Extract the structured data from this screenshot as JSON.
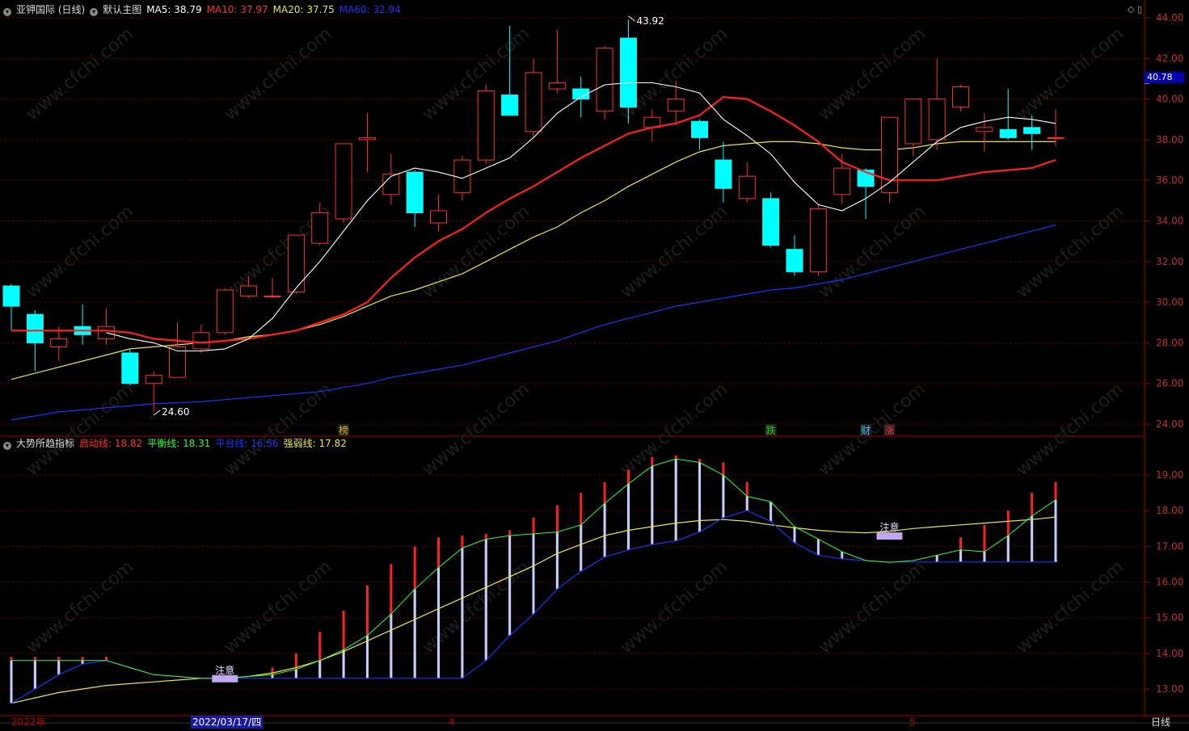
{
  "main_header": {
    "title": "亚钾国际 (日线)",
    "indicator": "默认主图",
    "ma5": "MA5: 38.79",
    "ma10": "MA10: 37.97",
    "ma20": "MA20: 37.75",
    "ma60": "MA60: 32.94"
  },
  "sub_header": {
    "title": "大势所趋指标",
    "qidong": "启动线: 18.82",
    "pingheng": "平衡线: 18.31",
    "pingtai": "平台线: 16.56",
    "qiangruo": "强弱线: 17.82"
  },
  "current_price": "40.78",
  "xaxis": {
    "year": "2022年",
    "cursor_date": "2022/03/17/四",
    "month_4": "4",
    "month_5": "5",
    "period": "日线"
  },
  "watermark": "www.cfchi.com",
  "colors": {
    "up": "#ff3030",
    "down": "#00ffff",
    "ma5": "#ffffff",
    "ma10": "#ff2020",
    "ma20": "#e8e840",
    "ma60": "#2030ff",
    "grid": "#a00000"
  },
  "chart_data": [
    {
      "type": "candlestick",
      "title": "亚钾国际 (日线)",
      "y_ticks": [
        "44.00",
        "42.00",
        "40.00",
        "38.00",
        "36.00",
        "34.00",
        "32.00",
        "30.00",
        "28.00",
        "26.00",
        "24.00"
      ],
      "ylim": [
        23.98,
        44.8
      ],
      "candles": [
        {
          "o": 30.8,
          "h": 30.9,
          "l": 28.6,
          "c": 29.8
        },
        {
          "o": 29.4,
          "h": 29.6,
          "l": 26.6,
          "c": 28.0
        },
        {
          "o": 27.8,
          "h": 28.8,
          "l": 27.1,
          "c": 28.2
        },
        {
          "o": 28.8,
          "h": 29.9,
          "l": 27.9,
          "c": 28.4
        },
        {
          "o": 28.2,
          "h": 29.7,
          "l": 27.9,
          "c": 28.8
        },
        {
          "o": 27.5,
          "h": 27.7,
          "l": 25.9,
          "c": 26.0
        },
        {
          "o": 26.0,
          "h": 26.6,
          "l": 24.6,
          "c": 26.4
        },
        {
          "o": 26.3,
          "h": 29.0,
          "l": 26.3,
          "c": 27.8
        },
        {
          "o": 27.7,
          "h": 28.9,
          "l": 27.5,
          "c": 28.5
        },
        {
          "o": 28.5,
          "h": 30.7,
          "l": 28.4,
          "c": 30.6
        },
        {
          "o": 30.3,
          "h": 31.3,
          "l": 30.2,
          "c": 30.8
        },
        {
          "o": 30.3,
          "h": 31.2,
          "l": 30.2,
          "c": 30.3
        },
        {
          "o": 30.5,
          "h": 33.3,
          "l": 30.4,
          "c": 33.3
        },
        {
          "o": 32.9,
          "h": 34.9,
          "l": 32.8,
          "c": 34.4
        },
        {
          "o": 34.1,
          "h": 37.8,
          "l": 33.9,
          "c": 37.8
        },
        {
          "o": 38.0,
          "h": 39.3,
          "l": 36.4,
          "c": 38.1
        },
        {
          "o": 35.3,
          "h": 37.3,
          "l": 34.8,
          "c": 36.3
        },
        {
          "o": 36.4,
          "h": 36.5,
          "l": 33.7,
          "c": 34.4
        },
        {
          "o": 33.9,
          "h": 35.3,
          "l": 33.5,
          "c": 34.5
        },
        {
          "o": 35.4,
          "h": 37.2,
          "l": 35.0,
          "c": 37.0
        },
        {
          "o": 37.0,
          "h": 40.7,
          "l": 36.8,
          "c": 40.4
        },
        {
          "o": 40.2,
          "h": 43.6,
          "l": 39.2,
          "c": 39.2
        },
        {
          "o": 38.4,
          "h": 42.0,
          "l": 38.1,
          "c": 41.3
        },
        {
          "o": 40.5,
          "h": 43.4,
          "l": 40.3,
          "c": 40.8
        },
        {
          "o": 40.5,
          "h": 41.1,
          "l": 39.1,
          "c": 40.0
        },
        {
          "o": 39.4,
          "h": 42.6,
          "l": 39.0,
          "c": 42.5
        },
        {
          "o": 43.0,
          "h": 43.9,
          "l": 38.8,
          "c": 39.6
        },
        {
          "o": 38.6,
          "h": 39.5,
          "l": 37.9,
          "c": 39.1
        },
        {
          "o": 39.4,
          "h": 40.9,
          "l": 38.7,
          "c": 40.0
        },
        {
          "o": 38.9,
          "h": 39.0,
          "l": 37.5,
          "c": 38.1
        },
        {
          "o": 37.0,
          "h": 37.9,
          "l": 34.9,
          "c": 35.6
        },
        {
          "o": 35.1,
          "h": 36.9,
          "l": 34.9,
          "c": 36.2
        },
        {
          "o": 35.1,
          "h": 35.4,
          "l": 32.7,
          "c": 32.8
        },
        {
          "o": 32.6,
          "h": 33.3,
          "l": 31.3,
          "c": 31.5
        },
        {
          "o": 31.5,
          "h": 34.8,
          "l": 31.3,
          "c": 34.6
        },
        {
          "o": 35.3,
          "h": 37.3,
          "l": 34.8,
          "c": 36.6
        },
        {
          "o": 36.5,
          "h": 36.6,
          "l": 34.1,
          "c": 35.7
        },
        {
          "o": 35.4,
          "h": 38.3,
          "l": 34.9,
          "c": 39.1
        },
        {
          "o": 37.8,
          "h": 40.0,
          "l": 37.2,
          "c": 40.0
        },
        {
          "o": 38.0,
          "h": 42.0,
          "l": 37.5,
          "c": 40.0
        },
        {
          "o": 39.6,
          "h": 40.7,
          "l": 39.4,
          "c": 40.6
        },
        {
          "o": 38.4,
          "h": 39.3,
          "l": 37.4,
          "c": 38.6
        },
        {
          "o": 38.5,
          "h": 40.5,
          "l": 38.0,
          "c": 38.1
        },
        {
          "o": 38.6,
          "h": 39.2,
          "l": 37.5,
          "c": 38.3
        },
        {
          "o": 38.1,
          "h": 39.5,
          "l": 37.7,
          "c": 38.1
        }
      ],
      "ma5": [
        null,
        null,
        null,
        null,
        28.5,
        28.2,
        28.0,
        27.6,
        27.6,
        27.7,
        28.2,
        29.2,
        30.7,
        32.0,
        33.5,
        35.0,
        36.2,
        36.6,
        36.4,
        36.1,
        36.6,
        37.1,
        38.1,
        39.3,
        40.1,
        40.7,
        40.8,
        40.8,
        40.6,
        40.3,
        39.0,
        38.2,
        37.3,
        35.9,
        34.8,
        34.5,
        35.1,
        35.9,
        36.9,
        37.9,
        38.6,
        38.9,
        39.1,
        39.0,
        38.8
      ],
      "ma10": [
        28.6,
        28.6,
        28.6,
        28.6,
        28.6,
        28.5,
        28.2,
        28.1,
        28.0,
        28.1,
        28.2,
        28.4,
        28.6,
        29.0,
        29.4,
        30.0,
        31.2,
        32.2,
        33.0,
        33.6,
        34.4,
        35.1,
        35.7,
        36.4,
        37.1,
        37.7,
        38.3,
        38.6,
        38.8,
        39.2,
        40.1,
        40.0,
        39.4,
        38.7,
        37.9,
        36.9,
        36.4,
        36.0,
        36.0,
        36.0,
        36.2,
        36.4,
        36.5,
        36.6,
        37.0
      ],
      "ma20": [
        26.2,
        26.5,
        26.8,
        27.1,
        27.4,
        27.7,
        27.8,
        27.9,
        28.0,
        28.1,
        28.3,
        28.4,
        28.6,
        28.9,
        29.3,
        29.8,
        30.3,
        30.6,
        31.0,
        31.4,
        32.0,
        32.6,
        33.2,
        33.7,
        34.4,
        35.0,
        35.7,
        36.3,
        36.9,
        37.4,
        37.7,
        37.8,
        37.9,
        37.9,
        37.8,
        37.6,
        37.5,
        37.5,
        37.6,
        37.8,
        37.9,
        37.9,
        37.9,
        37.9,
        37.9
      ],
      "ma60": [
        24.2,
        24.4,
        24.6,
        24.7,
        24.8,
        24.9,
        25.0,
        25.05,
        25.1,
        25.2,
        25.3,
        25.4,
        25.5,
        25.6,
        25.8,
        26.0,
        26.3,
        26.5,
        26.7,
        26.9,
        27.2,
        27.5,
        27.8,
        28.1,
        28.5,
        28.9,
        29.2,
        29.5,
        29.8,
        30.0,
        30.2,
        30.4,
        30.6,
        30.7,
        30.9,
        31.1,
        31.4,
        31.7,
        32.0,
        32.3,
        32.6,
        32.9,
        33.2,
        33.5,
        33.8
      ],
      "annotations": [
        {
          "label": "43.92",
          "candle": 26,
          "value": 43.92
        },
        {
          "label": "24.60",
          "candle": 6,
          "value": 24.6
        }
      ],
      "event_tags": [
        {
          "label": "榜",
          "candle": 14,
          "color": "#d8b020"
        },
        {
          "label": "跌",
          "candle": 32,
          "color": "#20d020"
        },
        {
          "label": "财",
          "candle": 36,
          "color": "#40c0ff"
        },
        {
          "label": "涨",
          "candle": 37,
          "color": "#ff3030"
        }
      ]
    },
    {
      "type": "line",
      "title": "大势所趋指标",
      "y_ticks": [
        "19.00",
        "18.00",
        "17.00",
        "16.00",
        "15.00",
        "14.00",
        "13.00"
      ],
      "ylim": [
        12.3,
        19.95
      ],
      "series": [
        {
          "name": "启动线",
          "color": "#ff2020",
          "values": [
            13.9,
            13.9,
            13.9,
            13.9,
            13.9,
            13.6,
            13.4,
            13.35,
            13.3,
            13.3,
            13.35,
            13.6,
            14.0,
            14.6,
            15.2,
            15.9,
            16.5,
            17.0,
            17.25,
            17.3,
            17.35,
            17.45,
            17.8,
            18.15,
            18.5,
            18.8,
            19.15,
            19.5,
            19.55,
            19.45,
            19.35,
            18.8,
            18.25,
            17.55,
            17.2,
            16.85,
            16.6,
            16.55,
            16.6,
            16.75,
            17.25,
            17.6,
            18.0,
            18.5,
            18.8
          ]
        },
        {
          "name": "平衡线",
          "color": "#30ff30",
          "values": [
            13.8,
            13.8,
            13.8,
            13.8,
            13.8,
            13.6,
            13.4,
            13.35,
            13.3,
            13.3,
            13.35,
            13.4,
            13.55,
            13.8,
            14.1,
            14.5,
            15.1,
            15.8,
            16.4,
            16.95,
            17.2,
            17.3,
            17.35,
            17.4,
            17.6,
            18.2,
            18.75,
            19.25,
            19.45,
            19.35,
            19.0,
            18.4,
            18.25,
            17.55,
            17.2,
            16.85,
            16.6,
            16.55,
            16.6,
            16.75,
            16.9,
            16.85,
            17.3,
            17.85,
            18.3
          ]
        },
        {
          "name": "平台线",
          "color": "#2030ff",
          "values": [
            12.6,
            13.0,
            13.4,
            13.7,
            13.8,
            13.6,
            13.4,
            13.35,
            13.3,
            13.3,
            13.3,
            13.3,
            13.3,
            13.3,
            13.3,
            13.3,
            13.3,
            13.3,
            13.3,
            13.3,
            13.8,
            14.5,
            15.1,
            15.8,
            16.3,
            16.7,
            16.9,
            17.05,
            17.15,
            17.4,
            17.8,
            18.0,
            17.7,
            17.1,
            16.75,
            16.65,
            16.6,
            16.56,
            16.56,
            16.56,
            16.56,
            16.56,
            16.56,
            16.56,
            16.56
          ]
        },
        {
          "name": "强弱线",
          "color": "#e8e840",
          "values": [
            12.6,
            12.75,
            12.9,
            13.0,
            13.1,
            13.15,
            13.2,
            13.25,
            13.3,
            13.3,
            13.35,
            13.45,
            13.6,
            13.8,
            14.05,
            14.35,
            14.65,
            14.95,
            15.25,
            15.55,
            15.85,
            16.15,
            16.45,
            16.8,
            17.05,
            17.3,
            17.45,
            17.55,
            17.65,
            17.72,
            17.75,
            17.7,
            17.6,
            17.52,
            17.45,
            17.4,
            17.38,
            17.42,
            17.5,
            17.55,
            17.6,
            17.65,
            17.7,
            17.75,
            17.82
          ]
        }
      ],
      "bars": {
        "colors": [
          "#ff2020",
          "#c0d0ff"
        ]
      },
      "annotations": [
        {
          "label": "注意",
          "candle": 9,
          "value": 13.3
        },
        {
          "label": "注意",
          "candle": 37,
          "value": 17.3
        }
      ]
    }
  ]
}
